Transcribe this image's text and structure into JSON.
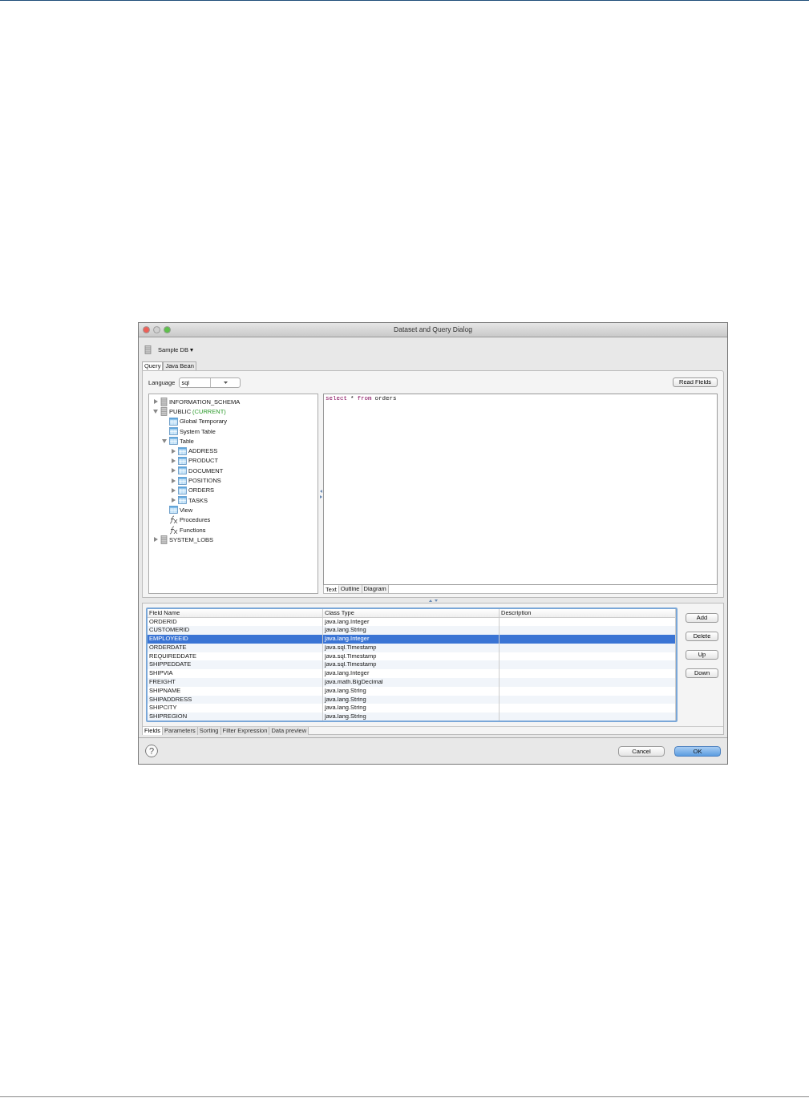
{
  "window": {
    "title": "Dataset and Query Dialog"
  },
  "toolbar": {
    "data_source": "Sample DB",
    "caret": "▾"
  },
  "tabs": [
    {
      "label": "Query",
      "selected": true
    },
    {
      "label": "Java Bean",
      "selected": false
    }
  ],
  "language": {
    "label": "Language",
    "value": "sql"
  },
  "read_fields_button": "Read Fields",
  "tree": [
    {
      "label": "INFORMATION_SCHEMA",
      "kind": "schema",
      "expanded": false
    },
    {
      "label": "PUBLIC",
      "note": "(CURRENT)",
      "kind": "schema",
      "expanded": true,
      "children": [
        {
          "label": "Global Temporary",
          "kind": "folder"
        },
        {
          "label": "System Table",
          "kind": "folder"
        },
        {
          "label": "Table",
          "kind": "folder",
          "expanded": true,
          "children": [
            {
              "label": "ADDRESS",
              "kind": "table",
              "expanded": false
            },
            {
              "label": "PRODUCT",
              "kind": "table",
              "expanded": false
            },
            {
              "label": "DOCUMENT",
              "kind": "table",
              "expanded": false
            },
            {
              "label": "POSITIONS",
              "kind": "table",
              "expanded": false
            },
            {
              "label": "ORDERS",
              "kind": "table",
              "expanded": false
            },
            {
              "label": "TASKS",
              "kind": "table",
              "expanded": false
            }
          ]
        },
        {
          "label": "View",
          "kind": "folder"
        },
        {
          "label": "Procedures",
          "kind": "function"
        },
        {
          "label": "Functions",
          "kind": "function"
        }
      ]
    },
    {
      "label": "SYSTEM_LOBS",
      "kind": "schema",
      "expanded": false
    }
  ],
  "editor": {
    "tokens": [
      {
        "text": "select",
        "kind": "keyword"
      },
      {
        "text": "*",
        "kind": "plain"
      },
      {
        "text": "from",
        "kind": "keyword"
      },
      {
        "text": "orders",
        "kind": "plain"
      }
    ]
  },
  "editor_tabs": [
    {
      "label": "Text",
      "selected": true
    },
    {
      "label": "Outline",
      "selected": false
    },
    {
      "label": "Diagram",
      "selected": false
    }
  ],
  "fields_table": {
    "columns": [
      "Field Name",
      "Class Type",
      "Description"
    ],
    "rows": [
      {
        "cells": [
          "ORDERID",
          "java.lang.Integer"
        ],
        "selected": false
      },
      {
        "cells": [
          "CUSTOMERID",
          "java.lang.String"
        ],
        "selected": false
      },
      {
        "cells": [
          "EMPLOYEEID",
          "java.lang.Integer"
        ],
        "selected": true
      },
      {
        "cells": [
          "ORDERDATE",
          "java.sql.Timestamp"
        ],
        "selected": false
      },
      {
        "cells": [
          "REQUIREDDATE",
          "java.sql.Timestamp"
        ],
        "selected": false
      },
      {
        "cells": [
          "SHIPPEDDATE",
          "java.sql.Timestamp"
        ],
        "selected": false
      },
      {
        "cells": [
          "SHIPVIA",
          "java.lang.Integer"
        ],
        "selected": false
      },
      {
        "cells": [
          "FREIGHT",
          "java.math.BigDecimal"
        ],
        "selected": false
      },
      {
        "cells": [
          "SHIPNAME",
          "java.lang.String"
        ],
        "selected": false
      },
      {
        "cells": [
          "SHIPADDRESS",
          "java.lang.String"
        ],
        "selected": false
      },
      {
        "cells": [
          "SHIPCITY",
          "java.lang.String"
        ],
        "selected": false
      },
      {
        "cells": [
          "SHIPREGION",
          "java.lang.String"
        ],
        "selected": false
      }
    ]
  },
  "field_buttons": [
    "Add",
    "Delete",
    "Up",
    "Down"
  ],
  "bottom_tabs": [
    {
      "label": "Fields",
      "selected": true
    },
    {
      "label": "Parameters",
      "selected": false
    },
    {
      "label": "Sorting",
      "selected": false
    },
    {
      "label": "Filter Expression",
      "selected": false
    },
    {
      "label": "Data preview",
      "selected": false
    }
  ],
  "help": "?",
  "footer_buttons": [
    {
      "label": "Cancel",
      "kind": "normal"
    },
    {
      "label": "OK",
      "kind": "default"
    }
  ]
}
